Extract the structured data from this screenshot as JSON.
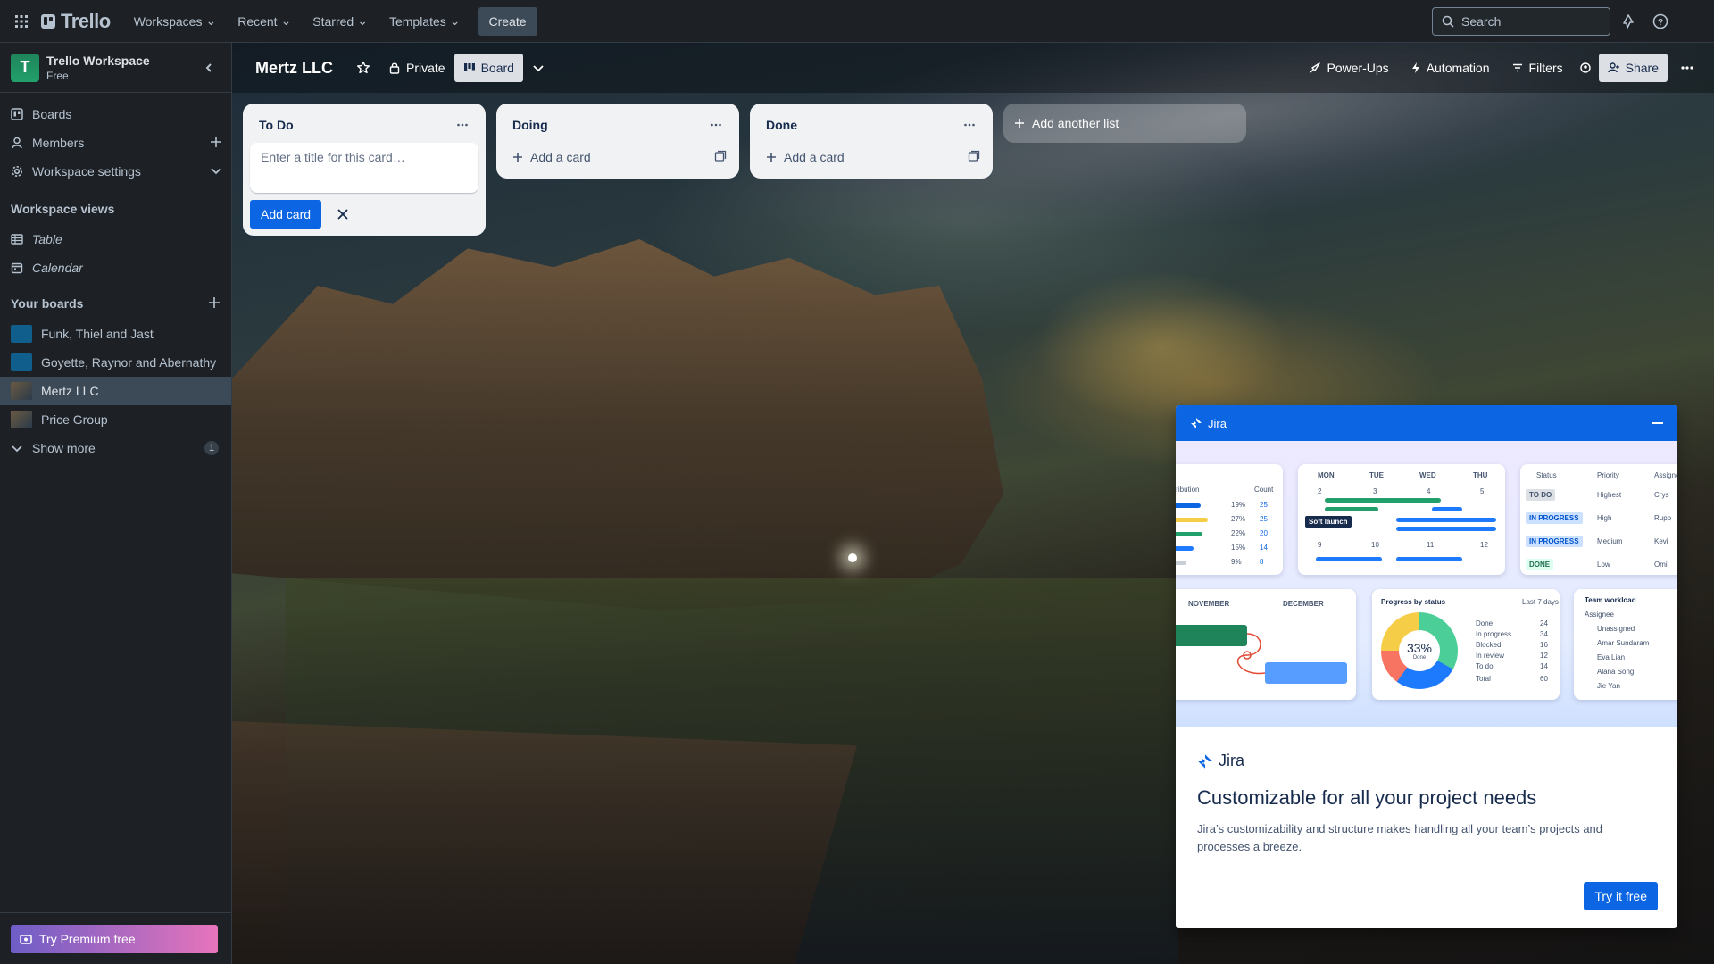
{
  "topbar": {
    "logo": "Trello",
    "menus": [
      "Workspaces",
      "Recent",
      "Starred",
      "Templates"
    ],
    "create": "Create",
    "search_placeholder": "Search"
  },
  "sidebar": {
    "workspace_initial": "T",
    "workspace_name": "Trello Workspace",
    "workspace_plan": "Free",
    "nav": [
      "Boards",
      "Members",
      "Workspace settings"
    ],
    "views_title": "Workspace views",
    "views": [
      "Table",
      "Calendar"
    ],
    "boards_title": "Your boards",
    "boards": [
      {
        "name": "Funk, Thiel and Jast",
        "color": "#0f5e8c"
      },
      {
        "name": "Goyette, Raynor and Abernathy",
        "color": "#0f5e8c"
      },
      {
        "name": "Mertz LLC",
        "color": "#4a4a3a"
      },
      {
        "name": "Price Group",
        "color": "#4a4a3a"
      }
    ],
    "show_more": "Show more",
    "show_more_count": "1",
    "premium": "Try Premium free"
  },
  "board": {
    "title": "Mertz LLC",
    "visibility": "Private",
    "view": "Board",
    "actions": [
      "Power-Ups",
      "Automation",
      "Filters"
    ],
    "share": "Share"
  },
  "lists": [
    {
      "title": "To Do",
      "composer_placeholder": "Enter a title for this card…",
      "add_button": "Add card"
    },
    {
      "title": "Doing",
      "add_card": "Add a card"
    },
    {
      "title": "Done",
      "add_card": "Add a card"
    }
  ],
  "add_list": "Add another list",
  "promo": {
    "bar_label": "Jira",
    "brand": "Jira",
    "title": "Customizable for all your project needs",
    "text": "Jira’s customizability and structure makes handling all your team’s projects and processes a breeze.",
    "cta": "Try it free",
    "art": {
      "distribution": "tribution",
      "count": "Count",
      "percents": [
        "19%",
        "27%",
        "22%",
        "15%",
        "9%"
      ],
      "counts": [
        "25",
        "25",
        "20",
        "14",
        "8"
      ],
      "days": [
        "MON",
        "TUE",
        "WED",
        "THU"
      ],
      "dates_top": [
        "2",
        "3",
        "4",
        "5"
      ],
      "dates_bottom": [
        "9",
        "10",
        "11",
        "12"
      ],
      "event_chip": "Soft launch",
      "status_header": "Status",
      "priority_header": "Priority",
      "assignee_header": "Assignee",
      "statuses": [
        "TO DO",
        "IN PROGRESS",
        "IN PROGRESS",
        "DONE"
      ],
      "priorities": [
        "Highest",
        "High",
        "Medium",
        "Low"
      ],
      "assignees": [
        "Crys",
        "Rupp",
        "Kevi",
        "Omi"
      ],
      "months": [
        "NOVEMBER",
        "DECEMBER"
      ],
      "progress_title": "Progress by status",
      "progress_range": "Last 7 days",
      "progress_value": "33%",
      "progress_caption": "Done",
      "legend": [
        "Done",
        "In progress",
        "Blocked",
        "In review",
        "To do",
        "Total"
      ],
      "legend_values": [
        "24",
        "34",
        "16",
        "12",
        "14",
        "60"
      ],
      "workload_title": "Team workload",
      "workload_header": "Assignee",
      "workload_people": [
        "Unassigned",
        "Amar Sundaram",
        "Eva Lian",
        "Alana Song",
        "Jie Yan"
      ]
    }
  }
}
